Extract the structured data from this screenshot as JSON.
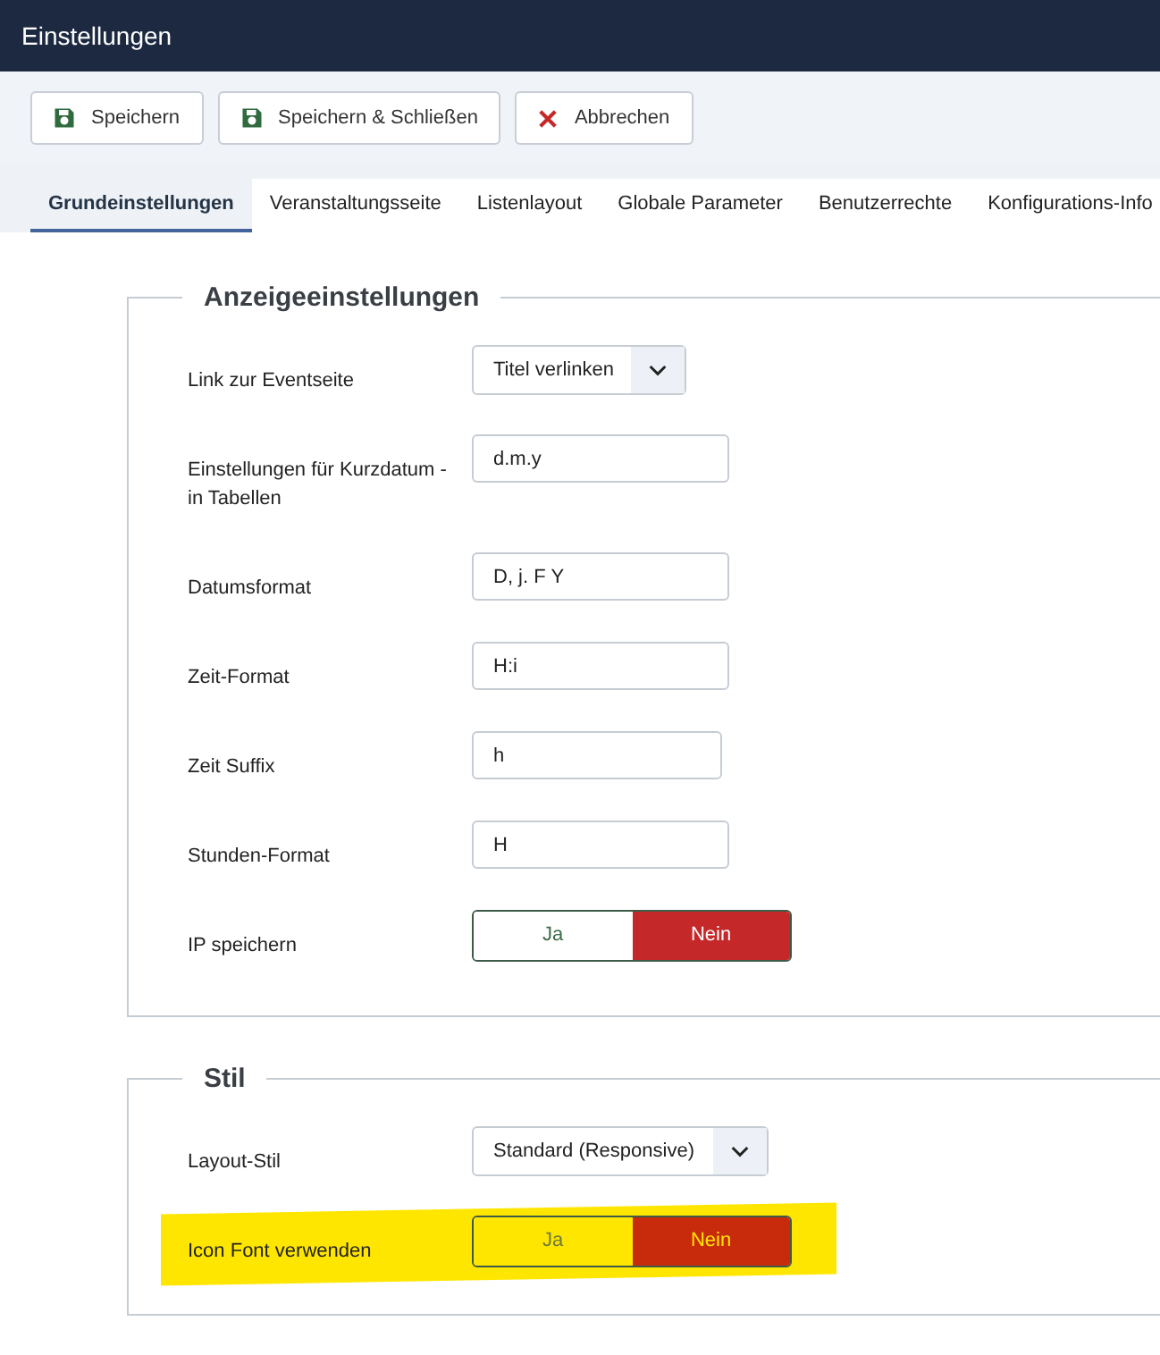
{
  "window": {
    "title": "Einstellungen"
  },
  "toolbar": [
    {
      "label": "Speichern",
      "kind": "save"
    },
    {
      "label": "Speichern & Schließen",
      "kind": "save"
    },
    {
      "label": "Abbrechen",
      "kind": "cancel"
    }
  ],
  "tabs": [
    {
      "label": "Grundeinstellungen",
      "selected": true
    },
    {
      "label": "Veranstaltungsseite",
      "selected": false
    },
    {
      "label": "Listenlayout",
      "selected": false
    },
    {
      "label": "Globale Parameter",
      "selected": false
    },
    {
      "label": "Benutzerrechte",
      "selected": false
    },
    {
      "label": "Konfigurations-Info",
      "selected": false
    }
  ],
  "sections": [
    {
      "title": "Anzeigeeinstellungen",
      "rows": [
        {
          "kind": "select",
          "label": "Link zur Eventseite",
          "value": "Titel verlinken",
          "highlighted": false
        },
        {
          "kind": "text",
          "label": "Einstellungen für Kurzdatum - in Tabellen",
          "value": "d.m.y",
          "highlighted": false
        },
        {
          "kind": "text",
          "label": "Datumsformat",
          "value": "D, j. F Y",
          "highlighted": false
        },
        {
          "kind": "text",
          "label": "Zeit-Format",
          "value": "H:i",
          "highlighted": false
        },
        {
          "kind": "text",
          "label": "Zeit Suffix",
          "value": "h",
          "highlighted": false
        },
        {
          "kind": "text",
          "label": "Stunden-Format",
          "value": "H",
          "highlighted": false
        },
        {
          "kind": "toggle",
          "label": "IP speichern",
          "options": [
            {
              "label": "Ja",
              "selected": false
            },
            {
              "label": "Nein",
              "selected": true
            }
          ],
          "highlighted": false
        }
      ]
    },
    {
      "title": "Stil",
      "rows": [
        {
          "kind": "select",
          "label": "Layout-Stil",
          "value": "Standard (Responsive)",
          "highlighted": false
        },
        {
          "kind": "toggle",
          "label": "Icon Font verwenden",
          "options": [
            {
              "label": "Ja",
              "selected": false
            },
            {
              "label": "Nein",
              "selected": true
            }
          ],
          "highlighted": true
        }
      ]
    }
  ]
}
